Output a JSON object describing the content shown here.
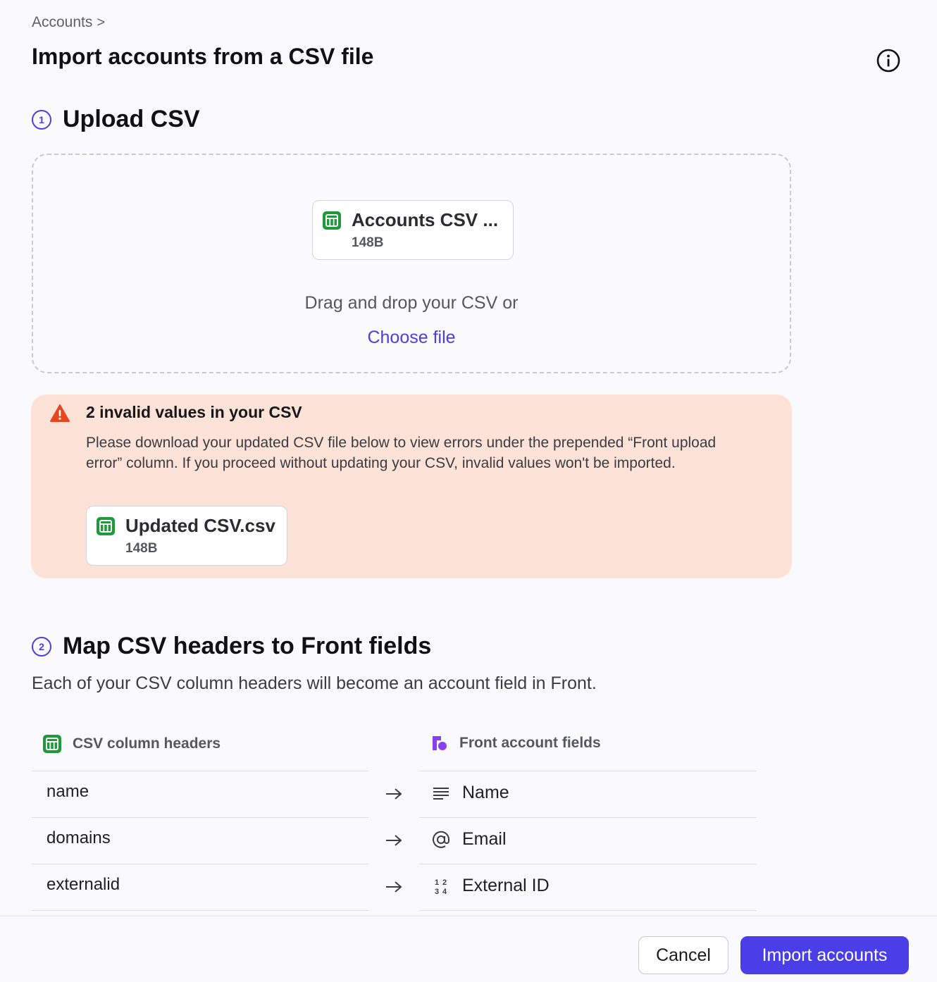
{
  "breadcrumb": {
    "label": "Accounts",
    "chevron": ">"
  },
  "page": {
    "title": "Import accounts from a CSV file"
  },
  "step1": {
    "number": "1",
    "title": "Upload CSV",
    "file": {
      "name": "Accounts CSV ...",
      "size": "148B"
    },
    "drop_text": "Drag and drop your CSV or",
    "choose_label": "Choose file"
  },
  "alert": {
    "title": "2 invalid values in your CSV",
    "body": "Please download your updated CSV file below to view errors under the prepended “Front upload error” column. If you proceed without updating your CSV, invalid values won't be imported.",
    "file": {
      "name": "Updated CSV.csv",
      "size": "148B"
    }
  },
  "step2": {
    "number": "2",
    "title": "Map CSV headers to Front fields",
    "description": "Each of your CSV column headers will become an account field in Front.",
    "csv_header": "CSV column headers",
    "front_header": "Front account fields",
    "rows": [
      {
        "csv": "name",
        "field": "Name",
        "icon": "text-lines-icon"
      },
      {
        "csv": "domains",
        "field": "Email",
        "icon": "at-sign-icon"
      },
      {
        "csv": "externalid",
        "field": "External ID",
        "icon": "number-icon"
      }
    ]
  },
  "footer": {
    "cancel_label": "Cancel",
    "import_label": "Import accounts"
  },
  "colors": {
    "accent": "#4a3ee6",
    "alert_bg": "#fde2d8",
    "warning": "#e8461c",
    "csv_green": "#1f9a3a",
    "front_purple": "#8a3ff0"
  }
}
